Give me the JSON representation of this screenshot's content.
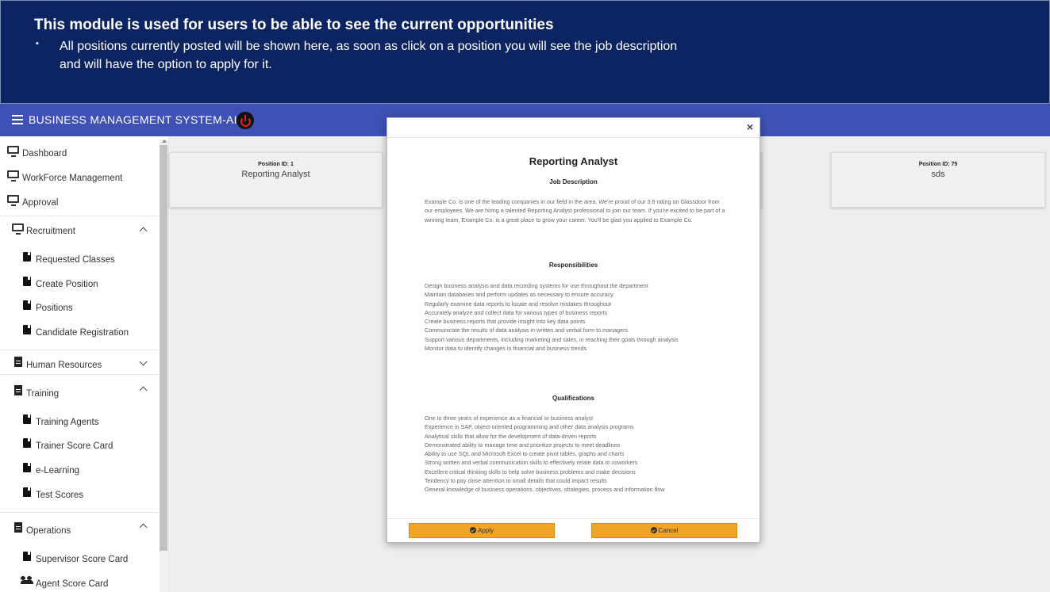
{
  "banner": {
    "title": "This module is used for users to be able to see the current opportunities",
    "bullet": "▪",
    "text": "All positions currently posted will be shown here, as soon as click on a position you will see the job description and will have the option to apply for it."
  },
  "header": {
    "title": "BUSINESS MANAGEMENT SYSTEM-AI"
  },
  "sidebar": {
    "dashboard": "Dashboard",
    "workforce": "WorkForce Management",
    "approval": "Approval",
    "recruitment": {
      "label": "Recruitment",
      "items": [
        "Requested Classes",
        "Create Position",
        "Positions",
        "Candidate Registration"
      ]
    },
    "human_resources": "Human Resources",
    "training": {
      "label": "Training",
      "items": [
        "Training Agents",
        "Trainer Score Card",
        "e-Learning",
        "Test Scores"
      ]
    },
    "operations": {
      "label": "Operations",
      "items": [
        "Supervisor Score Card",
        "Agent Score Card"
      ]
    }
  },
  "cards": [
    {
      "id": "Position ID: 1",
      "title": "Reporting Analyst"
    },
    {
      "id": "Position ID: 75",
      "title": "sds"
    }
  ],
  "modal": {
    "close": "×",
    "title": "Reporting Analyst",
    "job_description_heading": "Job Description",
    "job_description": "Example Co. is one of the leading companies in our field in the area. We're proud of our 3.6 rating on Glassdoor from our employees. We are hiring a talented Reporting Analyst professional to join our team. If you're excited to be part of a winning team, Example Co. is a great place to grow your career. You'll be glad you applied to Example Co.",
    "responsibilities_heading": "Responsibilities",
    "responsibilities": [
      "Design business analysis and data recording systems for use throughout the department",
      "Maintain databases and perform updates as necessary to ensure accuracy",
      "Regularly examine data reports to locate and resolve mistakes throughout",
      "Accurately analyze and collect data for various types of business reports",
      "Create business reports that provide insight into key data points",
      "Communicate the results of data analysis in written and verbal form to managers",
      "Support various departments, including marketing and sales, in reaching their goals through analysis",
      "Monitor data to identify changes in financial and business trends"
    ],
    "qualifications_heading": "Qualifications",
    "qualifications": [
      "One to three years of experience as a financial or business analyst",
      "Experience in SAP, object-oriented programming and other data analysis programs",
      "Analytical skills that allow for the development of data-driven reports",
      "Demonstrated ability to manage time and prioritize projects to meet deadlines",
      "Ability to use SQL and Microsoft Excel to create pivot tables, graphs and charts",
      "Strong written and verbal communication skills to effectively relate data to coworkers",
      "Excellent critical thinking skills to help solve business problems and make decisions",
      "Tendency to pay close attention to small details that could impact results",
      "General knowledge of business operations, objectives, strategies, process and information flow"
    ],
    "apply_label": "Apply",
    "cancel_label": "Cancel"
  },
  "colors": {
    "banner_bg": "#0c2461",
    "appbar_bg": "#3f51b5",
    "button_bg": "#f0a428"
  }
}
